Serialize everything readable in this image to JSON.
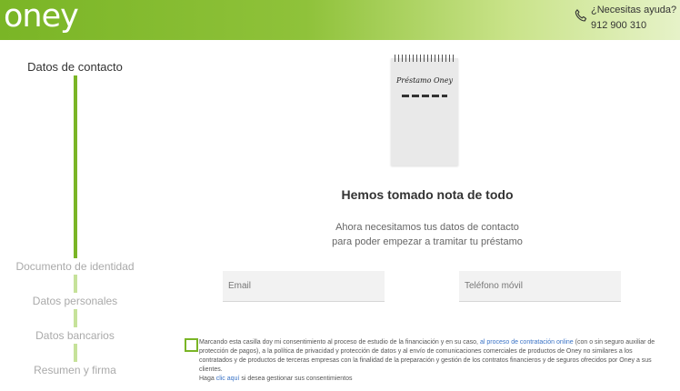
{
  "header": {
    "logo": "oney",
    "help_question": "¿Necesitas ayuda?",
    "help_phone": "912 900 310"
  },
  "stepper": {
    "steps": [
      {
        "label": "Datos de contacto",
        "active": true
      },
      {
        "label": "Documento de identidad",
        "active": false
      },
      {
        "label": "Datos personales",
        "active": false
      },
      {
        "label": "Datos bancarios",
        "active": false
      },
      {
        "label": "Resumen y firma",
        "active": false
      }
    ]
  },
  "main": {
    "notepad_title": "Préstamo Oney",
    "heading": "Hemos tomado nota de todo",
    "subtext_line1": "Ahora necesitamos tus datos de contacto",
    "subtext_line2": "para poder empezar a tramitar tu préstamo",
    "email_placeholder": "Email",
    "phone_placeholder": "Teléfono móvil"
  },
  "consent": {
    "text_before": "Marcando esta casilla doy mi consentimiento al proceso de estudio de la financiación y en su caso, ",
    "link": "al proceso de contratación online",
    "text_after": " (con o sin seguro auxiliar de protección de pagos), a la política de privacidad y protección de datos y al envío de comunicaciones comerciales de productos de Oney no similares a los contratados y de productos de terceras empresas con la finalidad de la preparación y gestión de los contratos financieros y de seguros ofrecidos por Oney a sus clientes.",
    "manage_prefix": "Haga ",
    "manage_link": "clic aquí",
    "manage_suffix": " si desea gestionar sus consentimientos",
    "checked": false
  },
  "colors": {
    "brand_green": "#7ab526",
    "link_blue": "#3a73c6"
  },
  "icons": [
    "phone-icon",
    "notepad-illustration"
  ]
}
